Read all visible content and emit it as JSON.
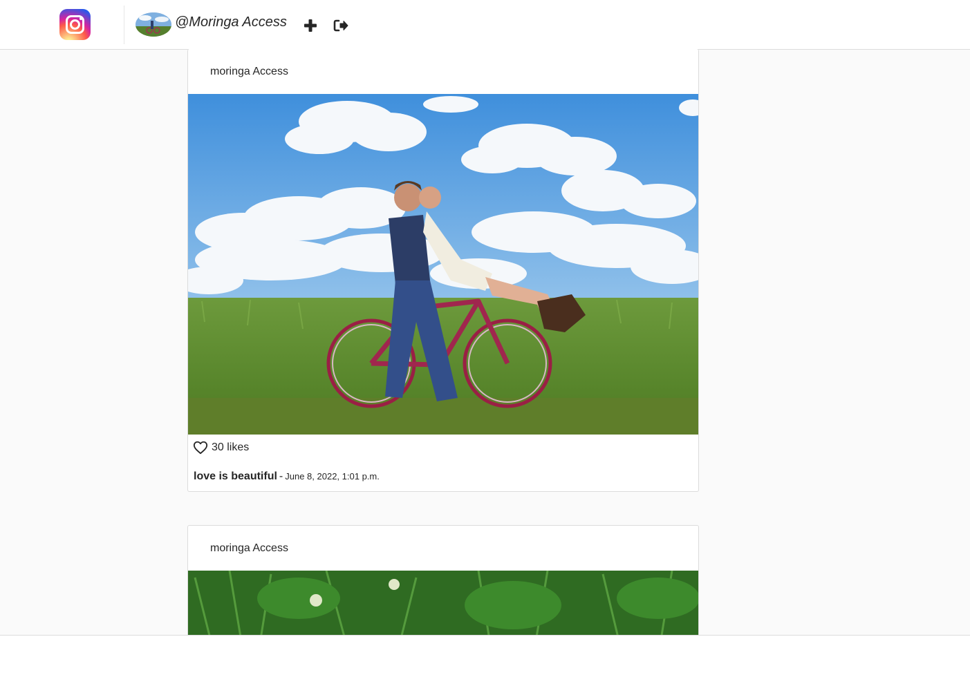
{
  "navbar": {
    "logo_icon": "instagram-logo-icon",
    "username": "@Moringa Access",
    "add_icon": "plus-icon",
    "logout_icon": "sign-out-icon"
  },
  "posts": [
    {
      "author": "moringa Access",
      "image_icon": "photo-couple-on-bicycle",
      "like_icon": "heart-outline-icon",
      "likes": "30 likes",
      "caption": "love is beautiful",
      "separator": "-",
      "date": "June 8, 2022, 1:01 p.m."
    },
    {
      "author": "moringa Access",
      "image_icon": "photo-white-flowers-green-leaves"
    }
  ],
  "colors": {
    "background": "#fafafa",
    "card": "#ffffff",
    "border": "#dbdbdb",
    "text": "#262626"
  }
}
